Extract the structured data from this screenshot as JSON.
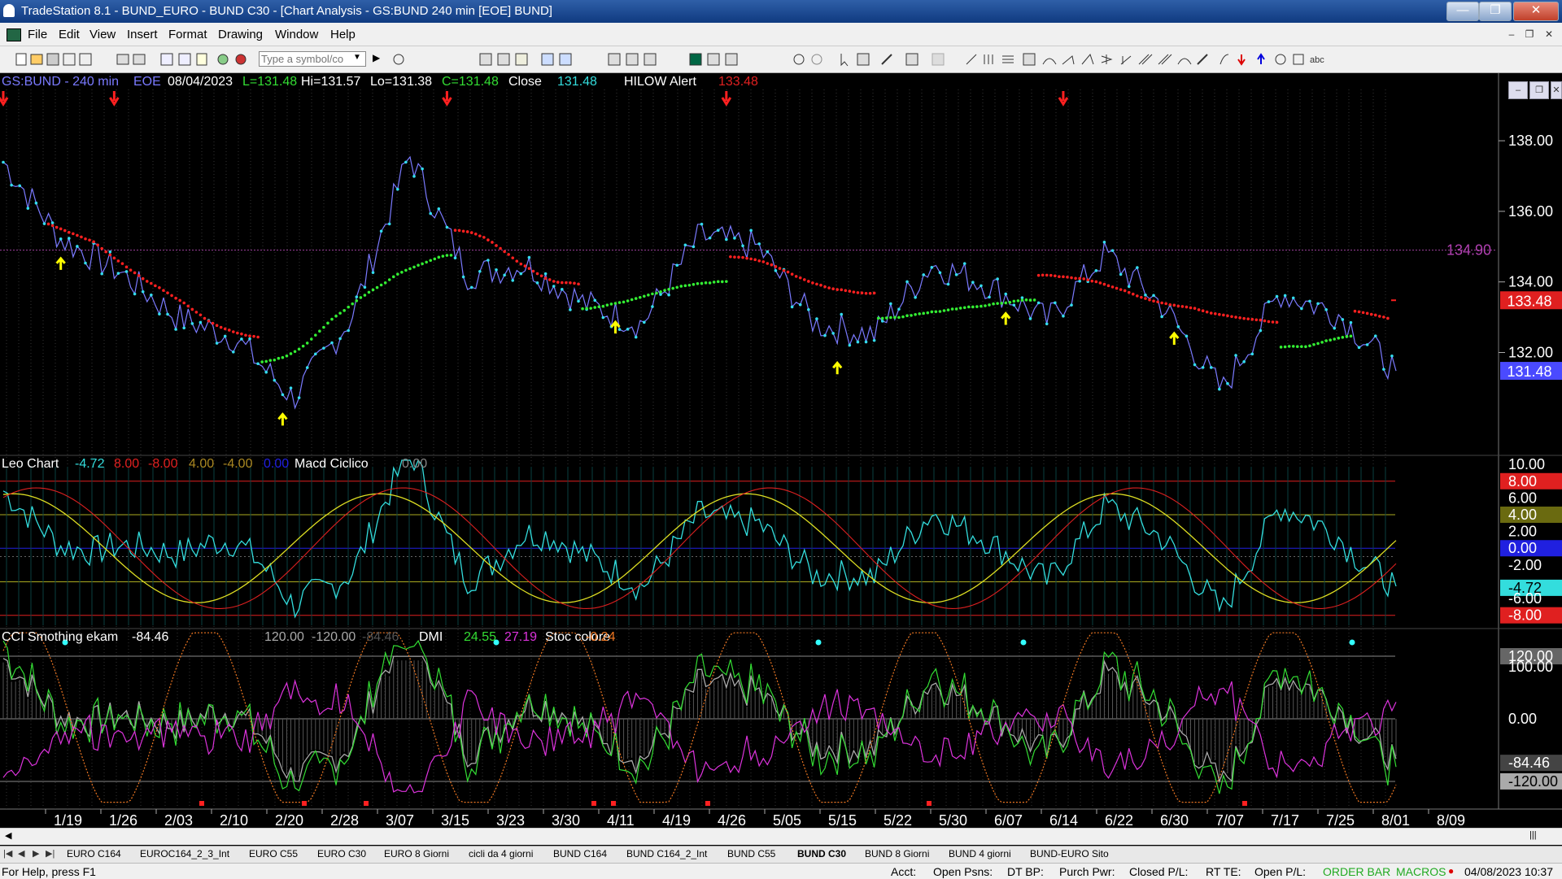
{
  "window": {
    "title": "TradeStation 8.1 - BUND_EURO - BUND  C30 - [Chart Analysis - GS:BUND  240 min  [EOE] BUND]",
    "minimize": "—",
    "maximize": "❐",
    "close": "✕"
  },
  "menu": [
    "File",
    "Edit",
    "View",
    "Insert",
    "Format",
    "Drawing",
    "Window",
    "Help"
  ],
  "mdi_controls": [
    "–",
    "❐",
    "✕"
  ],
  "toolbar": {
    "symbol_placeholder": "Type a symbol/co",
    "draw_text_tool": "abc"
  },
  "chart_header": {
    "symbol": "GS:BUND - 240 min",
    "exchange": "EOE",
    "date": "08/04/2023",
    "last": "L=131.48",
    "high": "Hi=131.57",
    "low": "Lo=131.38",
    "close": "C=131.48",
    "close_label": "Close",
    "close_value": "131.48",
    "indicator": "HILOW Alert",
    "indicator_value": "133.48"
  },
  "colors": {
    "price_line": "#7a7aff",
    "price_dots": "#33ddee",
    "ma_red": "#ff2020",
    "ma_green": "#33ee33",
    "arrow_down": "#ff2020",
    "arrow_up": "#ffff00",
    "macd_cyan": "#33dddd",
    "macd_yellow": "#dddd22",
    "macd_red": "#dd2020",
    "cci_gray": "#aaaaaa",
    "dmi_green": "#33dd33",
    "dmi_magenta": "#dd33dd",
    "stoc_orange": "#ee7722"
  },
  "chart_data": [
    {
      "type": "line",
      "title": "GS:BUND - 240 min",
      "x": [
        "1/19",
        "1/26",
        "2/03",
        "2/10",
        "2/20",
        "2/28",
        "3/07",
        "3/15",
        "3/23",
        "3/30",
        "4/11",
        "4/19",
        "4/26",
        "5/05",
        "5/15",
        "5/22",
        "5/30",
        "6/07",
        "6/14",
        "6/22",
        "6/30",
        "7/07",
        "7/17",
        "7/25",
        "8/01",
        "8/09"
      ],
      "price": [
        137.4,
        135.2,
        134.3,
        133.0,
        132.4,
        130.7,
        133.0,
        137.6,
        134.2,
        134.5,
        133.4,
        132.8,
        135.3,
        135.0,
        132.8,
        132.5,
        134.5,
        133.9,
        132.9,
        134.8,
        133.3,
        130.9,
        133.7,
        133.1,
        131.48
      ],
      "ylim": [
        129.5,
        139.5
      ],
      "yticks": [
        "138.00",
        "136.00",
        "134.00",
        "132.00"
      ],
      "level_line": "134.90",
      "last_price_label": "131.48",
      "indicator_label": "133.48",
      "arrows_down_at": [
        "1/19",
        "2/03",
        "3/23",
        "5/05",
        "6/01",
        "6/22"
      ],
      "arrows_up_at": [
        "1/26",
        "2/28",
        "4/19",
        "5/22",
        "6/14",
        "7/07"
      ]
    },
    {
      "type": "line",
      "title": "Leo Chart",
      "legend": [
        "-4.72",
        "8.00",
        "-8.00",
        "4.00",
        "-4.00",
        "0.00",
        "Macd Ciclico",
        "0.00"
      ],
      "levels": [
        8,
        4,
        0,
        -4,
        -8
      ],
      "ylim": [
        -9,
        10.5
      ],
      "axis_labels": [
        "10.00",
        "8.00",
        "6.00",
        "4.00",
        "2.00",
        "0.00",
        "-2.00",
        "-4.72",
        "-6.00",
        "-8.00"
      ]
    },
    {
      "type": "line",
      "title": "CCI Smothing ekam",
      "legend": [
        "-84.46",
        "120.00",
        "-120.00",
        "-84.46",
        "DMI",
        "24.55",
        "27.19",
        "Stoc colore",
        "-0.24"
      ],
      "levels": [
        120,
        0,
        -120
      ],
      "ylim": [
        -170,
        170
      ],
      "axis_labels": [
        "120.00",
        "100.00",
        "0.00",
        "-84.46",
        "-120.00"
      ]
    }
  ],
  "x_axis": [
    "1/19",
    "1/26",
    "2/03",
    "2/10",
    "2/20",
    "2/28",
    "3/07",
    "3/15",
    "3/23",
    "3/30",
    "4/11",
    "4/19",
    "4/26",
    "5/05",
    "5/15",
    "5/22",
    "5/30",
    "6/07",
    "6/14",
    "6/22",
    "6/30",
    "7/07",
    "7/17",
    "7/25",
    "8/01",
    "8/09"
  ],
  "tabs": [
    "EURO C164",
    "EUROC164_2_3_Int",
    "EURO C55",
    "EURO C30",
    "EURO 8 Giorni",
    "cicli da 4 giorni",
    "BUND C164",
    "BUND C164_2_Int",
    "BUND C55",
    "BUND  C30",
    "BUND 8 Giorni",
    "BUND 4 giorni",
    "BUND-EURO Sito"
  ],
  "active_tab": "BUND  C30",
  "status": {
    "help": "For Help, press F1",
    "acct": "Acct:",
    "open_psns": "Open Psns:",
    "dt_bp": "DT BP:",
    "purch_pwr": "Purch Pwr:",
    "closed_pl": "Closed P/L:",
    "rt_te": "RT TE:",
    "open_pl": "Open P/L:",
    "order_bar": "ORDER BAR",
    "macros": "MACROS",
    "datetime": "04/08/2023 10:37"
  }
}
